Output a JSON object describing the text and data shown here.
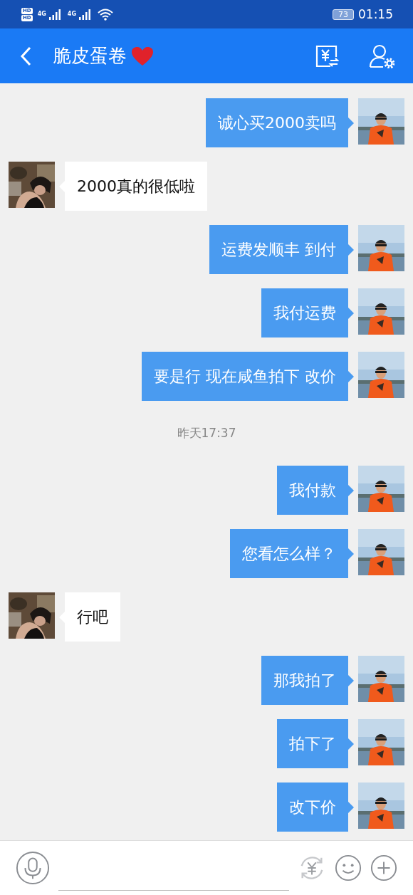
{
  "status_bar": {
    "sim_labels": [
      "HD",
      "HD"
    ],
    "networks": [
      "4G",
      "4G"
    ],
    "battery": "73",
    "time": "01:15"
  },
  "header": {
    "title": "脆皮蛋卷"
  },
  "messages": [
    {
      "kind": "outgoing",
      "text": "诚心买2000卖吗"
    },
    {
      "kind": "incoming",
      "text": "2000真的很低啦"
    },
    {
      "kind": "outgoing",
      "text": "运费发顺丰 到付"
    },
    {
      "kind": "outgoing",
      "text": "我付运费"
    },
    {
      "kind": "outgoing",
      "text": "要是行 现在咸鱼拍下 改价"
    },
    {
      "kind": "time",
      "text": "昨天17:37"
    },
    {
      "kind": "outgoing",
      "text": "我付款"
    },
    {
      "kind": "outgoing",
      "text": "您看怎么样？"
    },
    {
      "kind": "incoming",
      "text": "行吧"
    },
    {
      "kind": "outgoing",
      "text": "那我拍了"
    },
    {
      "kind": "outgoing",
      "text": "拍下了"
    },
    {
      "kind": "outgoing",
      "text": "改下价"
    }
  ]
}
